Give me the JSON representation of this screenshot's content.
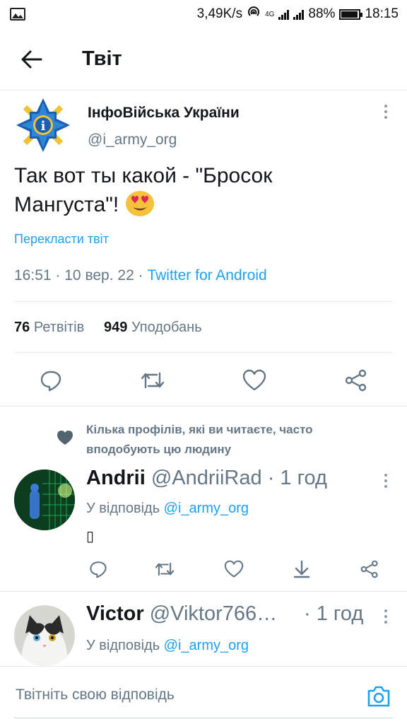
{
  "status_bar": {
    "speed": "3,49K/s",
    "network": "4G",
    "battery": "88%",
    "time": "18:15"
  },
  "header": {
    "title": "Твіт"
  },
  "tweet": {
    "author_name": "ІнфоВійська України",
    "author_handle": "@i_army_org",
    "text": "Так вот ты какой - \"Бросок Мангуста\"!",
    "emoji": "smiling-face-with-heart-eyes",
    "translate_label": "Перекласти твіт",
    "time": "16:51",
    "date": "10 вер. 22",
    "separator": "·",
    "client": "Twitter for Android",
    "retweets_count": "76",
    "retweets_label": "Ретвітів",
    "likes_count": "949",
    "likes_label": "Уподобань"
  },
  "social_context": {
    "text": "Кілька профілів, які ви читаєте, часто вподобують цю людину"
  },
  "replies": [
    {
      "name": "Andrii",
      "handle": "@AndriiRad",
      "time": "· 1 год",
      "in_reply_prefix": "У відповідь ",
      "in_reply_handle": "@i_army_org",
      "body": "▯"
    },
    {
      "name": "Victor",
      "handle": "@Viktor766…",
      "time": "· 1 год",
      "in_reply_prefix": "У відповідь ",
      "in_reply_handle": "@i_army_org"
    }
  ],
  "compose": {
    "placeholder": "Твітніть свою відповідь"
  },
  "colors": {
    "accent": "#1da1f2",
    "secondary_text": "#657786",
    "divider": "#e6ecf0"
  }
}
